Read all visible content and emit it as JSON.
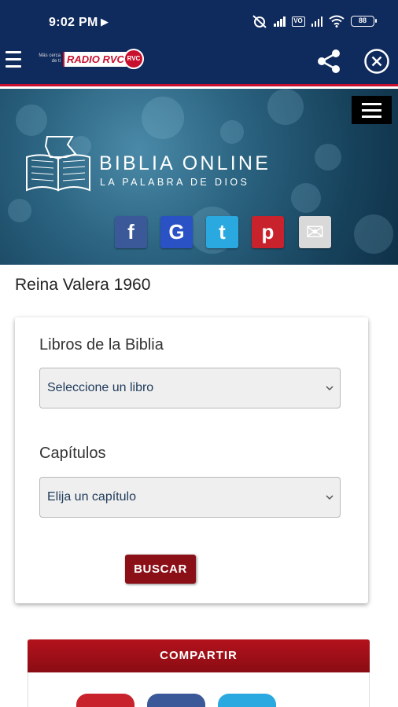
{
  "status_bar": {
    "time": "9:02 PM",
    "battery": "88",
    "icons": [
      "play-icon",
      "alarm-off-icon",
      "signal-icon",
      "volte-icon",
      "signal-icon",
      "wifi-icon",
      "battery-icon"
    ]
  },
  "app_bar": {
    "logo_small": "Más cerca de ti",
    "logo_main": "RADIO RVC",
    "logo_badge": "RVC",
    "icons": [
      "menu-icon",
      "share-icon",
      "close-icon"
    ]
  },
  "banner": {
    "title": "BIBLIA ONLINE",
    "subtitle": "LA PALABRA DE DIOS",
    "social": [
      {
        "name": "facebook",
        "glyph": "f",
        "color": "#3b5998"
      },
      {
        "name": "google",
        "glyph": "G",
        "color": "#2b52c4"
      },
      {
        "name": "twitter",
        "glyph": "t",
        "color": "#2aa9e0"
      },
      {
        "name": "pinterest",
        "glyph": "p",
        "color": "#c8232c"
      },
      {
        "name": "email",
        "glyph": "✉",
        "color": "#d9d9d9"
      }
    ]
  },
  "content": {
    "version": "Reina Valera 1960",
    "books_label": "Libros de la Biblia",
    "books_select": "Seleccione un libro",
    "chapters_label": "Capítulos",
    "chapters_select": "Elija un capítulo",
    "search_button": "BUSCAR"
  },
  "share_section": {
    "title": "COMPARTIR",
    "colors": [
      "#c8232c",
      "#3b5998",
      "#2aa9e0"
    ]
  }
}
